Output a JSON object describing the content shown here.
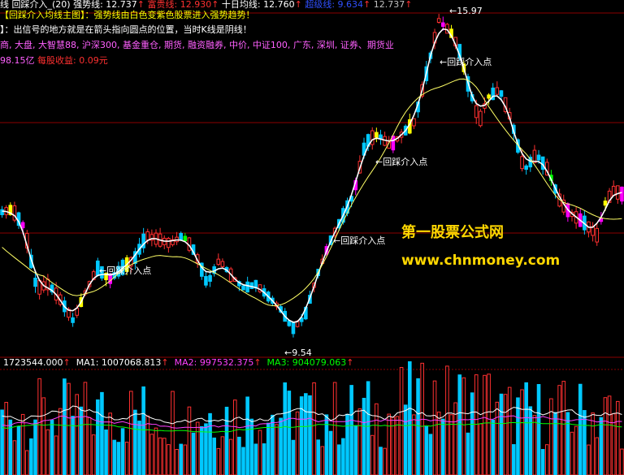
{
  "header": {
    "line1": [
      {
        "text": "线",
        "color": "#ffffff"
      },
      {
        "text": " 回踩介入_(20) ",
        "color": "#ffffff"
      },
      {
        "text": "强势线: 12.737",
        "color": "#ffffff"
      },
      {
        "text": "↑",
        "color": "#ff3030"
      },
      {
        "text": " 富贵线: 12.930",
        "color": "#ff3030"
      },
      {
        "text": "↑",
        "color": "#ff3030"
      },
      {
        "text": " 十日均线: 12.760",
        "color": "#ffffff"
      },
      {
        "text": "↑",
        "color": "#ff3030"
      },
      {
        "text": " 超级线: 9.634",
        "color": "#3050ff"
      },
      {
        "text": "↑",
        "color": "#ff3030"
      },
      {
        "text": " 12.737",
        "color": "#c0c0c0"
      },
      {
        "text": "↑",
        "color": "#ff3030"
      }
    ],
    "line2": "【回踩介入均线主图】：强势线由白色变紫色股票进入强势趋势！",
    "line3": "】：出信号的地方就是在箭头指向圆点的位置，当时K线是阴线！",
    "line4": "商, 大盘, 大智慧88, 沪深300, 基金重仓, 期货, 融资融券, 中价, 中证100, 广东, 深圳, 证券、期货业",
    "line5a": "98.15亿",
    "line5b": " 每股收益: 0.09元"
  },
  "colors": {
    "up": "#ff3030",
    "down": "#00c8ff",
    "yellow_candle": "#ffff00",
    "magenta_candle": "#ff00ff",
    "green_candle": "#00ff00",
    "ma_white": "#ffffff",
    "ma_yellow": "#ffff66",
    "ma_magenta": "#ff40ff",
    "ma_green": "#00ff00",
    "grid": "#8b0000",
    "watermark": "#ffd700"
  },
  "annotations": {
    "high_label": "15.97",
    "low_label": "9.54",
    "entry_label": "回踩介入点"
  },
  "watermark": {
    "line1": "第一股票公式网",
    "line2": "www.chnmoney.com"
  },
  "volume_header": {
    "vol": "1723544.000",
    "ma1": "MA1: 1007068.813",
    "ma2": "MA2: 997532.375",
    "ma3": "MA3: 904079.063",
    "arrow": "↑"
  }
}
